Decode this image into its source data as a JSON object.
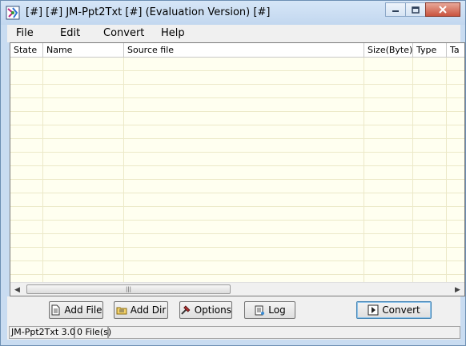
{
  "window": {
    "title": "[#] [#] JM-Ppt2Txt [#] (Evaluation Version) [#]"
  },
  "menu": {
    "items": [
      "File",
      "Edit",
      "Convert",
      "Help"
    ],
    "mnemonics": [
      "F",
      "E",
      "v",
      "H"
    ]
  },
  "table": {
    "columns": [
      "State",
      "Name",
      "Source file",
      "Size(Byte)",
      "Type",
      "Ta"
    ],
    "rows": []
  },
  "buttons": {
    "add_file": "Add File",
    "add_dir": "Add Dir",
    "options": "Options",
    "log": "Log",
    "convert": "Convert"
  },
  "status": {
    "app_version": "JM-Ppt2Txt 3.0",
    "file_count": "0 File(s)"
  },
  "scrollbar": {
    "grip": "|||"
  },
  "colors": {
    "grid_background": "#fffff0",
    "window_frame": "#c9dcf1",
    "close_button": "#c9533e"
  },
  "icons": [
    "app-icon",
    "minimize-icon",
    "maximize-icon",
    "close-icon",
    "add-file-icon",
    "add-dir-icon",
    "options-icon",
    "log-icon",
    "convert-icon",
    "scroll-left-icon",
    "scroll-right-icon"
  ]
}
